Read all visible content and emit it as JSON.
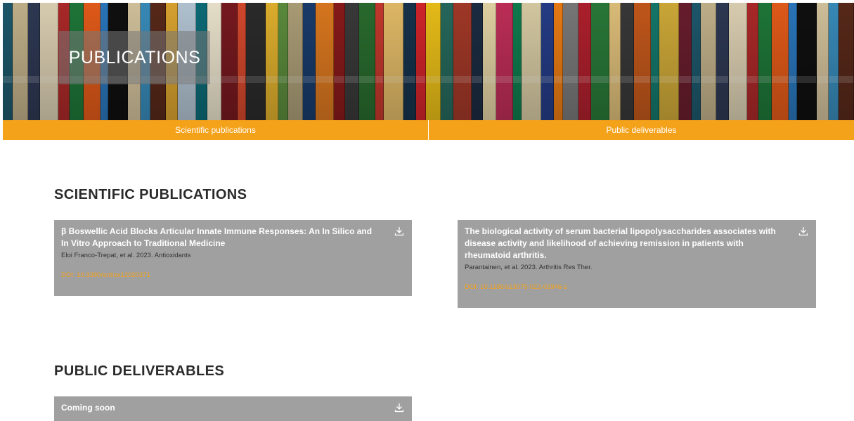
{
  "hero": {
    "title": "PUBLICATIONS"
  },
  "tabs": [
    {
      "label": "Scientific publications"
    },
    {
      "label": "Public deliverables"
    }
  ],
  "sections": {
    "scientific": {
      "title": "SCIENTIFIC PUBLICATIONS",
      "cards": [
        {
          "title": "β Boswellic Acid Blocks Articular Innate Immune Responses: An In Silico and In Vitro Approach to Traditional Medicine",
          "meta": "Eloi Franco-Trepat, et al. 2023. Antioxidants",
          "doi": "DOI: 10.3390/antiox12020371",
          "icon": "download-icon"
        },
        {
          "title": "The biological activity of serum bacterial lipopolysaccharides associates with disease activity and likelihood of achieving remission in patients with rheumatoid arthritis.",
          "meta": "Parantainen, et al. 2023. Arthritis Res Ther.",
          "doi": "DOI: 10.1186/s13075-022-02946-z",
          "icon": "download-icon"
        }
      ]
    },
    "deliverables": {
      "title": "PUBLIC DELIVERABLES",
      "cards": [
        {
          "title": "Coming soon",
          "icon": "download-icon"
        }
      ]
    }
  },
  "colors": {
    "accent": "#f5a21b",
    "card_bg": "#a0a0a0",
    "heading": "#2b2b2b",
    "book_spines": [
      "#1e5a6e",
      "#c7b68e",
      "#2f3a55",
      "#e2d6b8",
      "#b02a2a",
      "#1f7a3a",
      "#e85d1a",
      "#2a79c0",
      "#101010",
      "#d8c7a0",
      "#3a8fbf",
      "#5a2a1a",
      "#e0a830",
      "#b7c9d8",
      "#0c6e7a",
      "#f1e9d2",
      "#7a1a20",
      "#d94a2e",
      "#2c2c2c",
      "#e6b52f",
      "#5e8f3e",
      "#b0a27a",
      "#1a3d6e",
      "#e07b20",
      "#8c1b1b",
      "#3b3b3b",
      "#2a6e2f",
      "#c93a2e",
      "#e8c06a",
      "#17344d",
      "#d7262b",
      "#f0c419",
      "#276b5e",
      "#a63a29",
      "#1d2d44",
      "#e9d9a9",
      "#c42f5a",
      "#0f7f4f",
      "#ddd0a8",
      "#263e8a",
      "#f07f14",
      "#7c7c7c",
      "#b3212e",
      "#2a7c3a",
      "#e4c47d",
      "#3a3a3a",
      "#c85a1c",
      "#157a6e",
      "#d4ae3a",
      "#6b1e2e"
    ]
  }
}
